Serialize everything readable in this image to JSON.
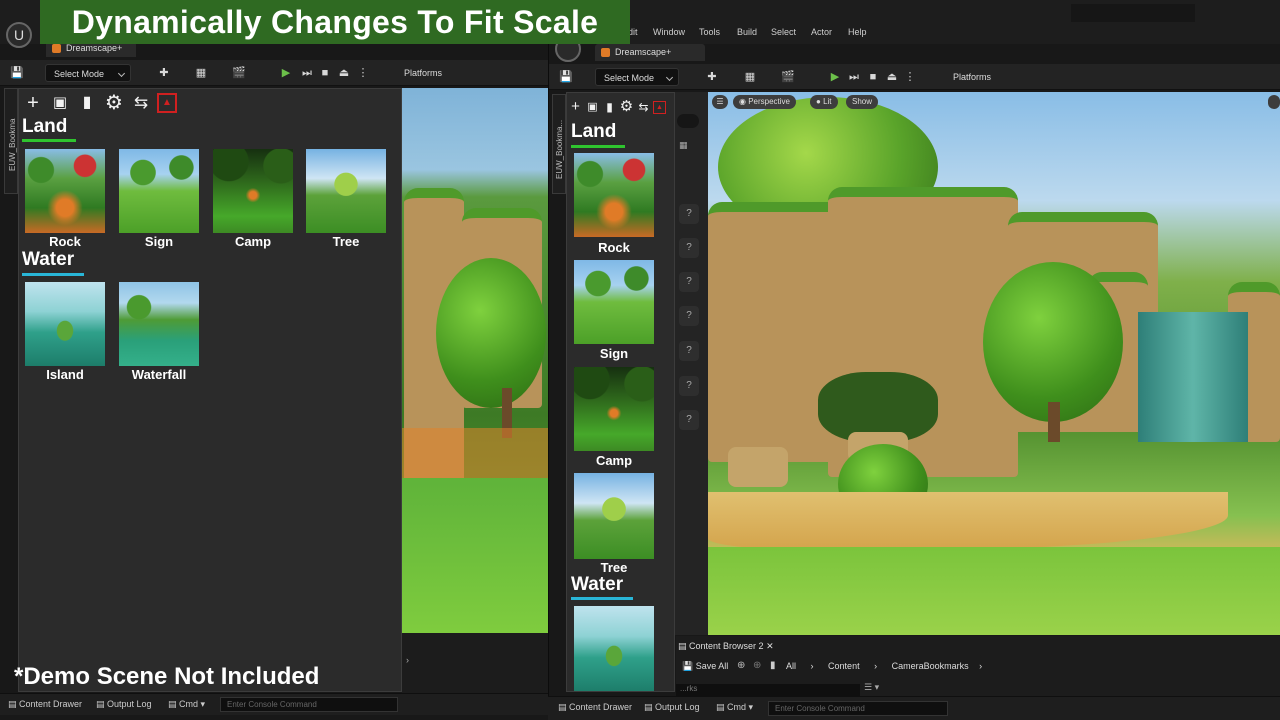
{
  "banner": "Dynamically Changes To Fit Scale",
  "demo_note": "*Demo Scene Not Included",
  "project_tab": "Dreamscape+",
  "project_tab_left": "Dreamscape+",
  "menu": [
    "dit",
    "Window",
    "Tools",
    "Build",
    "Select",
    "Actor",
    "Help"
  ],
  "toolbar": {
    "select_mode": "Select Mode",
    "platforms": "Platforms"
  },
  "panel": {
    "side_tab": "EUW_Bookma",
    "side_tab_right": "EUW_Bookma...",
    "sections": [
      {
        "title": "Land",
        "items": [
          "Rock",
          "Sign",
          "Camp",
          "Tree"
        ],
        "color": "#2fc42f"
      },
      {
        "title": "Water",
        "items": [
          "Island",
          "Waterfall"
        ],
        "color": "#29b6d8"
      }
    ]
  },
  "viewport": {
    "perspective": "Perspective",
    "lit": "Lit",
    "show": "Show"
  },
  "content_browser": {
    "tab": "Content Browser 2",
    "save_all": "Save All",
    "crumbs": [
      "All",
      "Content",
      "CameraBookmarks"
    ],
    "partial": "...rks"
  },
  "status": {
    "content_drawer": "Content Drawer",
    "output_log": "Output Log",
    "cmd": "Cmd",
    "console_placeholder": "Enter Console Command"
  },
  "icons": [
    "plus-icon",
    "camera-icon",
    "folder-icon",
    "gear-icon",
    "refresh-icon",
    "image-icon"
  ]
}
